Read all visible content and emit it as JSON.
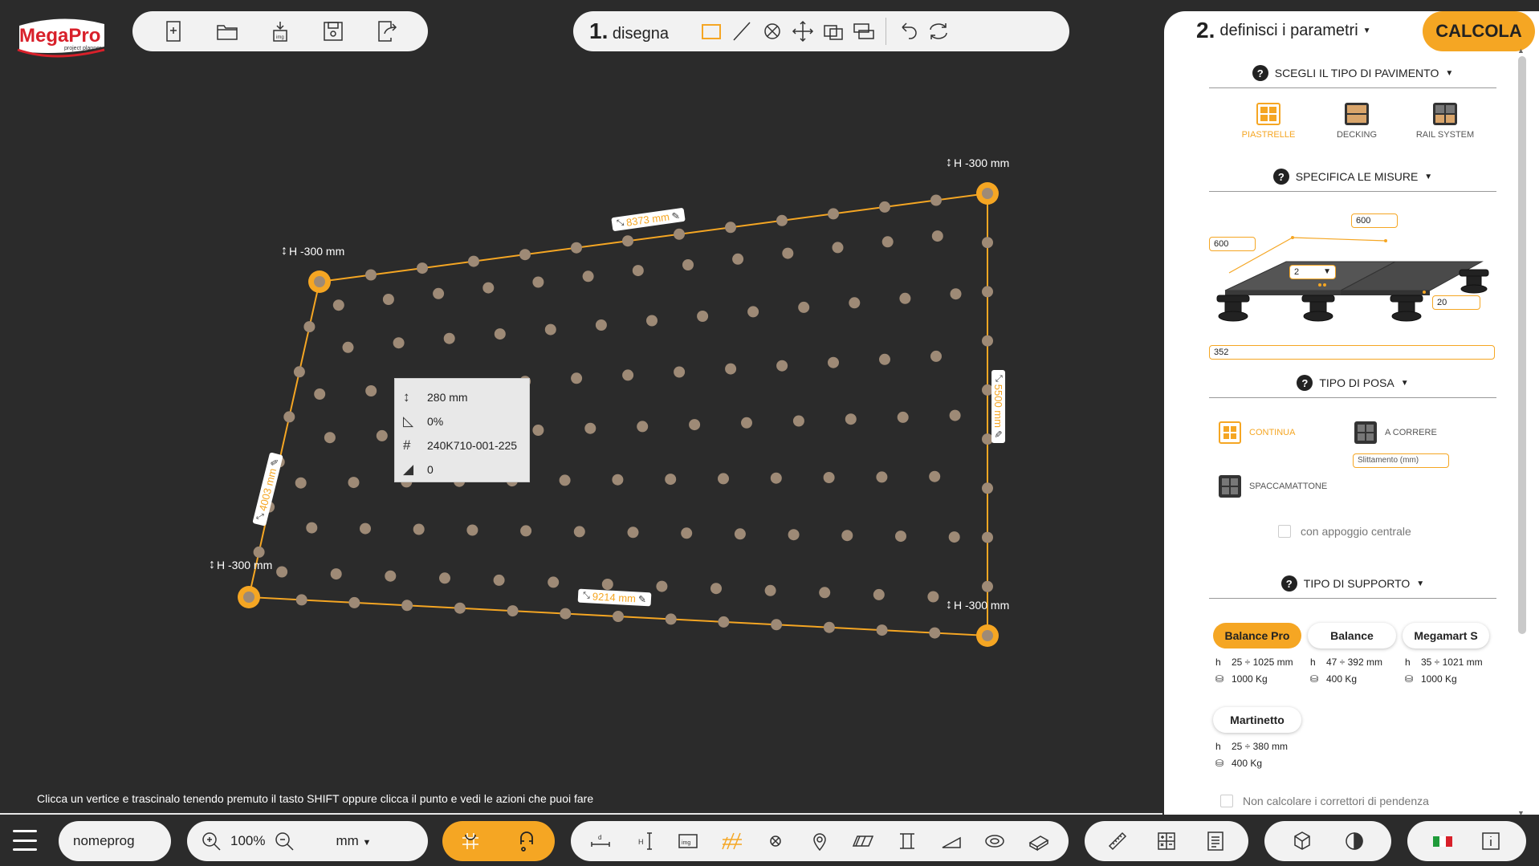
{
  "app": {
    "logo_text": "MegaPro",
    "logo_sub": "project planner",
    "hint": "Clicca un vertice e trascinalo tenendo premuto il tasto SHIFT oppure clicca il punto e vedi le azioni che puoi fare"
  },
  "draw_step": {
    "num": "1.",
    "label": "disegna"
  },
  "params_step": {
    "num": "2.",
    "label": "definisci i parametri"
  },
  "calcola": "CALCOLA",
  "canvas": {
    "heights": [
      "H -300 mm",
      "H -300 mm",
      "H -300 mm",
      "H -300 mm"
    ],
    "dims": {
      "top": "8373 mm",
      "left": "4003 mm",
      "bottom": "9214 mm",
      "right": "5500 mm"
    },
    "info": {
      "height": "280 mm",
      "slope": "0%",
      "code": "240K710-001-225",
      "wedge": "0"
    }
  },
  "pavimento": {
    "title": "SCEGLI IL TIPO DI PAVIMENTO",
    "types": [
      {
        "label": "PIASTRELLE",
        "icon": "tiles-icon",
        "active": true
      },
      {
        "label": "DECKING",
        "icon": "decking-icon",
        "active": false
      },
      {
        "label": "RAIL SYSTEM",
        "icon": "rail-system-icon",
        "active": false
      }
    ]
  },
  "misure": {
    "title": "SPECIFICA LE MISURE",
    "width": "600",
    "length": "600",
    "joint_select": "2",
    "thickness": "20",
    "height_total": "352"
  },
  "posa": {
    "title": "TIPO DI POSA",
    "continua": "CONTINUA",
    "a_correre": "A CORRERE",
    "slittamento": "Slittamento (mm)",
    "spaccamattone": "SPACCAMATTONE",
    "central": "con appoggio centrale"
  },
  "supporto": {
    "title": "TIPO DI SUPPORTO",
    "items": [
      {
        "label": "Balance Pro",
        "range": "25 ÷ 1025 mm",
        "load": "1000 Kg",
        "active": true
      },
      {
        "label": "Balance",
        "range": "47 ÷ 392 mm",
        "load": "400 Kg",
        "active": false
      },
      {
        "label": "Megamart S",
        "range": "35 ÷ 1021 mm",
        "load": "1000 Kg",
        "active": false
      },
      {
        "label": "Martinetto",
        "range": "25 ÷ 380 mm",
        "load": "400 Kg",
        "active": false
      }
    ],
    "no_slope": "Non calcolare i correttori di pendenza"
  },
  "bottom": {
    "project_name": "nomeprog",
    "zoom": "100%",
    "unit": "mm"
  },
  "colors": {
    "accent": "#f5a623",
    "dark": "#2b2b2b",
    "dot": "#9e8a76"
  }
}
